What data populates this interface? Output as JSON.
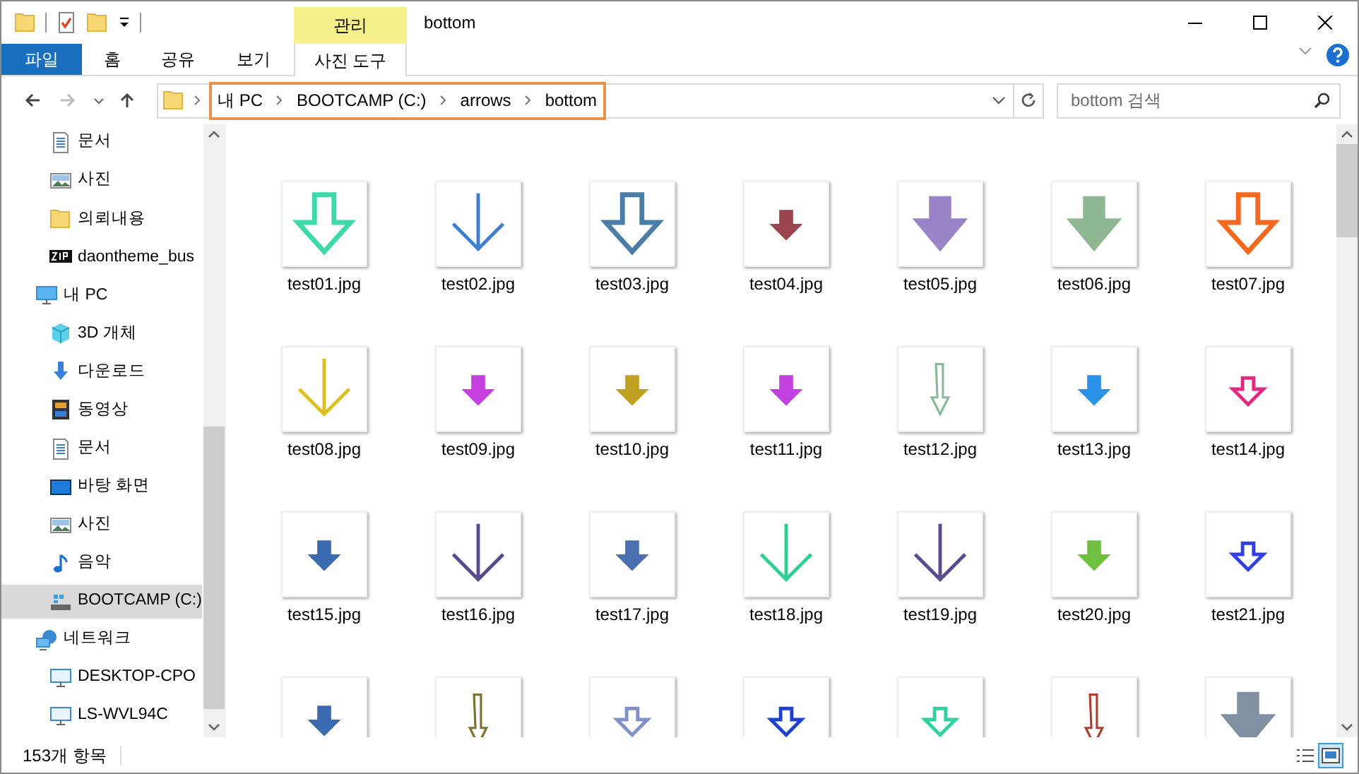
{
  "window": {
    "title": "bottom",
    "context_tab": "관리"
  },
  "ribbon_tabs": [
    {
      "label": "파일",
      "kind": "file"
    },
    {
      "label": "홈",
      "kind": "tab"
    },
    {
      "label": "공유",
      "kind": "tab"
    },
    {
      "label": "보기",
      "kind": "tab"
    },
    {
      "label": "사진 도구",
      "kind": "context"
    }
  ],
  "address": {
    "path": [
      "내 PC",
      "BOOTCAMP (C:)",
      "arrows",
      "bottom"
    ]
  },
  "search": {
    "placeholder": "bottom 검색"
  },
  "sidebar": {
    "items": [
      {
        "children": [
          {
            "label": "문서",
            "kind": "doc",
            "selected": false
          },
          {
            "label": "사진",
            "kind": "picture",
            "selected": false
          },
          {
            "label": "의뢰내용",
            "kind": "folder",
            "selected": false
          },
          {
            "label": "daontheme_bus",
            "kind": "zip",
            "selected": false
          }
        ]
      },
      {
        "label": "내 PC",
        "kind": "pc",
        "selected": false,
        "children": [
          {
            "label": "3D 개체",
            "kind": "cube",
            "selected": false
          },
          {
            "label": "다운로드",
            "kind": "download",
            "selected": false
          },
          {
            "label": "동영상",
            "kind": "video",
            "selected": false
          },
          {
            "label": "문서",
            "kind": "doc",
            "selected": false
          },
          {
            "label": "바탕 화면",
            "kind": "desktop",
            "selected": false
          },
          {
            "label": "사진",
            "kind": "picture",
            "selected": false
          },
          {
            "label": "음악",
            "kind": "music",
            "selected": false
          },
          {
            "label": "BOOTCAMP (C:)",
            "kind": "drive",
            "selected": true
          }
        ]
      },
      {
        "label": "네트워크",
        "kind": "network",
        "selected": false,
        "children": [
          {
            "label": "DESKTOP-CPO",
            "kind": "computer",
            "selected": false
          },
          {
            "label": "LS-WVL94C",
            "kind": "computer",
            "selected": false
          }
        ]
      }
    ]
  },
  "files": [
    {
      "name": "test01.jpg",
      "kind": "outline",
      "color": "#3ed9a8"
    },
    {
      "name": "test02.jpg",
      "kind": "line",
      "color": "#3f7fd0"
    },
    {
      "name": "test03.jpg",
      "kind": "outline",
      "color": "#4a7ea8"
    },
    {
      "name": "test04.jpg",
      "kind": "small",
      "color": "#9b4550"
    },
    {
      "name": "test05.jpg",
      "kind": "solid",
      "color": "#9a84c8"
    },
    {
      "name": "test06.jpg",
      "kind": "solid",
      "color": "#8fb892"
    },
    {
      "name": "test07.jpg",
      "kind": "outline",
      "color": "#f5691e"
    },
    {
      "name": "test08.jpg",
      "kind": "line",
      "color": "#e0c020"
    },
    {
      "name": "test09.jpg",
      "kind": "small",
      "color": "#c640e0"
    },
    {
      "name": "test10.jpg",
      "kind": "small",
      "color": "#c0a020"
    },
    {
      "name": "test11.jpg",
      "kind": "small",
      "color": "#c040e0"
    },
    {
      "name": "test12.jpg",
      "kind": "thin",
      "color": "#8cb89a"
    },
    {
      "name": "test13.jpg",
      "kind": "small",
      "color": "#2a90e8"
    },
    {
      "name": "test14.jpg",
      "kind": "smalloutline",
      "color": "#e02a80"
    },
    {
      "name": "test15.jpg",
      "kind": "small",
      "color": "#3a6ab0"
    },
    {
      "name": "test16.jpg",
      "kind": "line",
      "color": "#5a4a90"
    },
    {
      "name": "test17.jpg",
      "kind": "small",
      "color": "#4a70b0"
    },
    {
      "name": "test18.jpg",
      "kind": "line",
      "color": "#30d090"
    },
    {
      "name": "test19.jpg",
      "kind": "line",
      "color": "#5a4a90"
    },
    {
      "name": "test20.jpg",
      "kind": "small",
      "color": "#70c040"
    },
    {
      "name": "test21.jpg",
      "kind": "smalloutline",
      "color": "#3040e0"
    },
    {
      "kind": "small",
      "color": "#3a6ab0"
    },
    {
      "kind": "thin",
      "color": "#807030"
    },
    {
      "kind": "smalloutline",
      "color": "#8090c8"
    },
    {
      "kind": "smalloutline",
      "color": "#2040d0"
    },
    {
      "kind": "smalloutline",
      "color": "#30d0a0"
    },
    {
      "kind": "thin",
      "color": "#b04030"
    },
    {
      "kind": "solid",
      "color": "#8090a0"
    }
  ],
  "status_bar": {
    "item_count": "153개 항목"
  }
}
